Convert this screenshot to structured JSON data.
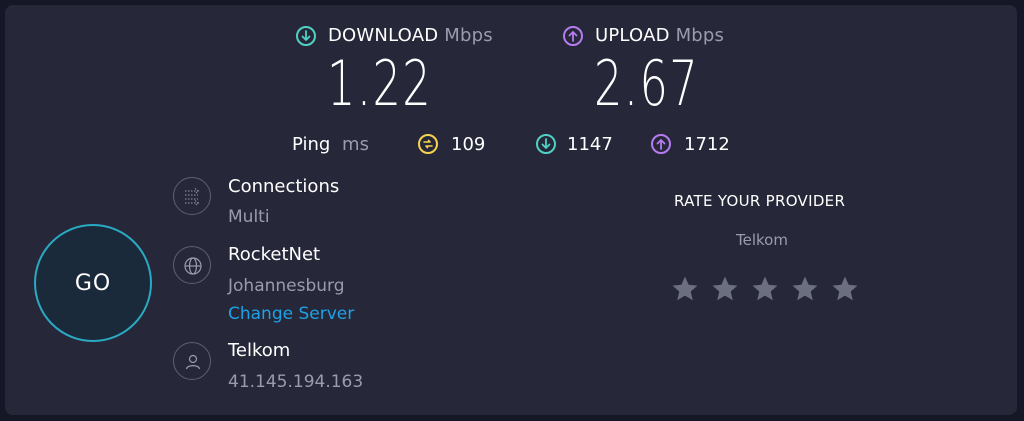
{
  "download": {
    "label": "DOWNLOAD",
    "unit": "Mbps",
    "value": "1.22",
    "color": "#4fd1c5"
  },
  "upload": {
    "label": "UPLOAD",
    "unit": "Mbps",
    "value": "2.67",
    "color": "#b57cf0"
  },
  "ping": {
    "label": "Ping",
    "unit": "ms",
    "idle": "109",
    "download": "1147",
    "upload": "1712",
    "idle_color": "#f6d34e"
  },
  "go_label": "GO",
  "connections": {
    "title": "Connections",
    "value": "Multi"
  },
  "server": {
    "title": "RocketNet",
    "location": "Johannesburg",
    "change_link": "Change Server"
  },
  "provider": {
    "title": "Telkom",
    "ip": "41.145.194.163"
  },
  "rating": {
    "title": "RATE YOUR PROVIDER",
    "provider": "Telkom",
    "stars_total": 5,
    "stars_selected": 0,
    "star_color": "#6c6f80"
  },
  "icons": [
    "download-icon",
    "upload-icon",
    "ping-idle-icon",
    "connections-icon",
    "globe-icon",
    "person-icon",
    "star-icon"
  ]
}
